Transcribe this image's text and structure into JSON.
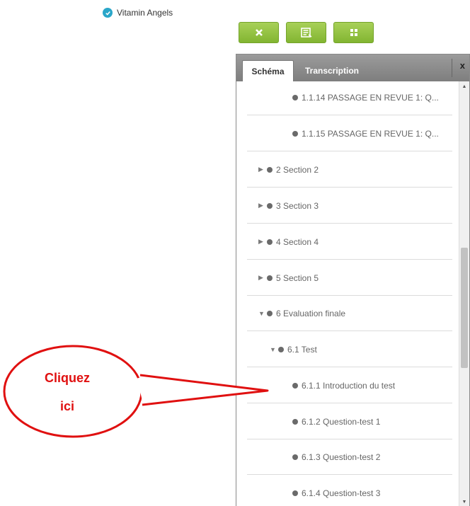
{
  "brand": {
    "name": "Vitamin Angels",
    "icon": "check-circle-icon",
    "icon_color": "#2aa6c9"
  },
  "toolbar": {
    "buttons": [
      {
        "icon": "close-icon"
      },
      {
        "icon": "notes-icon"
      },
      {
        "icon": "grid-icon"
      }
    ],
    "color": "#8cc03c"
  },
  "panel": {
    "tabs": [
      {
        "label": "Schéma",
        "active": true
      },
      {
        "label": "Transcription",
        "active": false
      }
    ],
    "close_label": "x",
    "items": [
      {
        "label": "1.1.14 PASSAGE EN REVUE 1: Q...",
        "expander": ""
      },
      {
        "label": "1.1.15 PASSAGE EN REVUE 1: Q...",
        "expander": ""
      },
      {
        "label": "2 Section 2",
        "expander": "▶"
      },
      {
        "label": "3 Section 3",
        "expander": "▶"
      },
      {
        "label": "4 Section 4",
        "expander": "▶"
      },
      {
        "label": "5 Section 5",
        "expander": "▶"
      },
      {
        "label": "6 Evaluation finale",
        "expander": "▼"
      },
      {
        "label": "6.1 Test",
        "expander": "▼"
      },
      {
        "label": "6.1.1 Introduction du test",
        "expander": ""
      },
      {
        "label": "6.1.2 Question-test 1",
        "expander": ""
      },
      {
        "label": "6.1.3 Question-test 2",
        "expander": ""
      },
      {
        "label": "6.1.4 Question-test 3",
        "expander": ""
      }
    ]
  },
  "callout": {
    "line1": "Cliquez",
    "line2": "ici",
    "color": "#e01010"
  }
}
